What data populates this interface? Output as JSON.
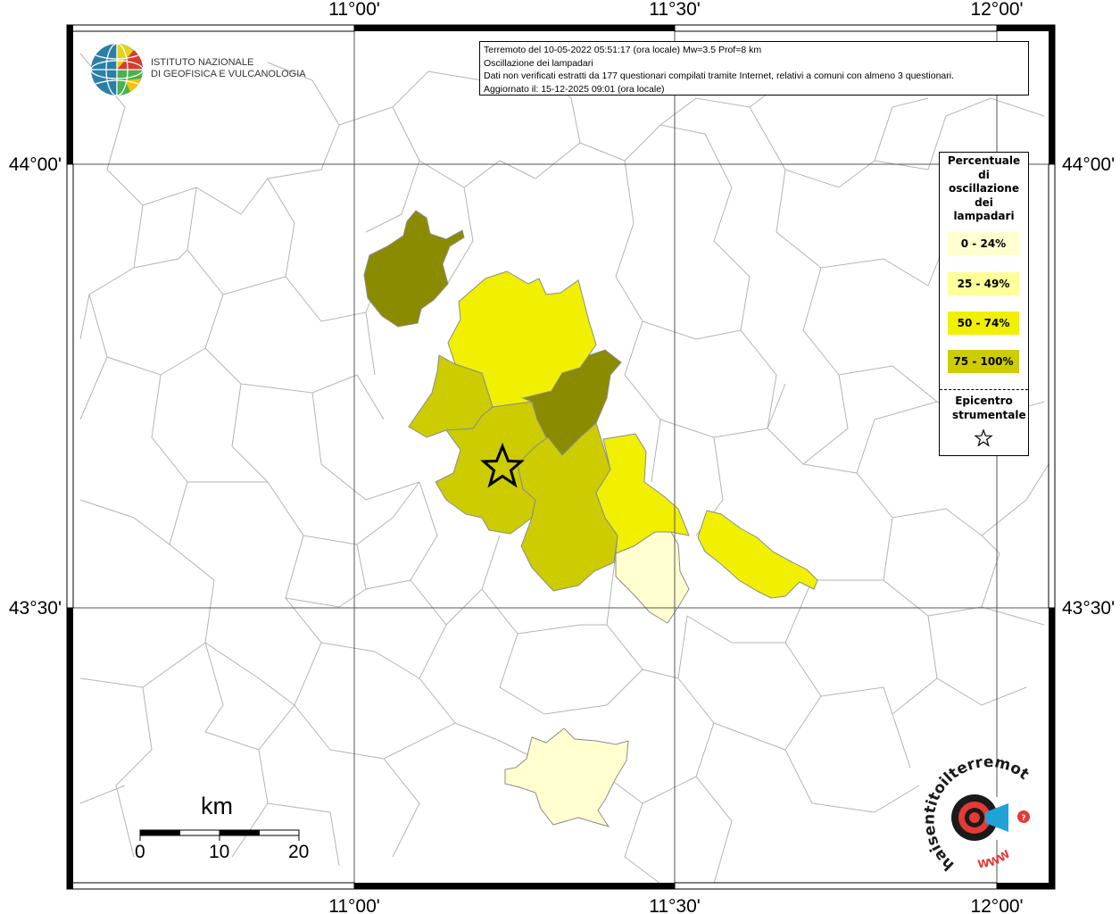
{
  "map": {
    "lon_labels": [
      "11°00'",
      "11°30'",
      "12°00'"
    ],
    "lat_labels": [
      "44°00'",
      "43°30'"
    ]
  },
  "info": {
    "line1": "Terremoto del 10-05-2022 05:51:17 (ora locale) Mw=3.5 Prof=8 km",
    "line2": "Oscillazione dei lampadari",
    "line3": "Dati non verificati estratti da 177 questionari compilati tramite Internet, relativi a comuni con almeno 3 questionari.",
    "line4": "Aggiornato il: 15-12-2025 09:01 (ora locale)"
  },
  "legend": {
    "title": "Percentuale di oscillazione dei lampadari",
    "items": [
      {
        "label": "0 - 24%",
        "color": "#ffffd0"
      },
      {
        "label": "25 - 49%",
        "color": "#ffff99"
      },
      {
        "label": "50 - 74%",
        "color": "#f0f000"
      },
      {
        "label": "75 - 100%",
        "color": "#cccc00"
      }
    ],
    "epicenter_label": "Epicentro strumentale"
  },
  "municipality_colors": {
    "c0_24": "#ffffd0",
    "c25_49": "#ffff99",
    "c50_74": "#f0f000",
    "c75_100": "#cccc00",
    "dark": "#8b8b00"
  },
  "logo": {
    "ingv_line1": "ISTITUTO NAZIONALE",
    "ingv_line2": "DI GEOFISICA E VULCANOLOGIA",
    "hsit_text": "haisentitoilterremoto.it",
    "hsit_www": "WWW"
  },
  "scale": {
    "unit": "km",
    "ticks": [
      "0",
      "10",
      "20"
    ]
  }
}
